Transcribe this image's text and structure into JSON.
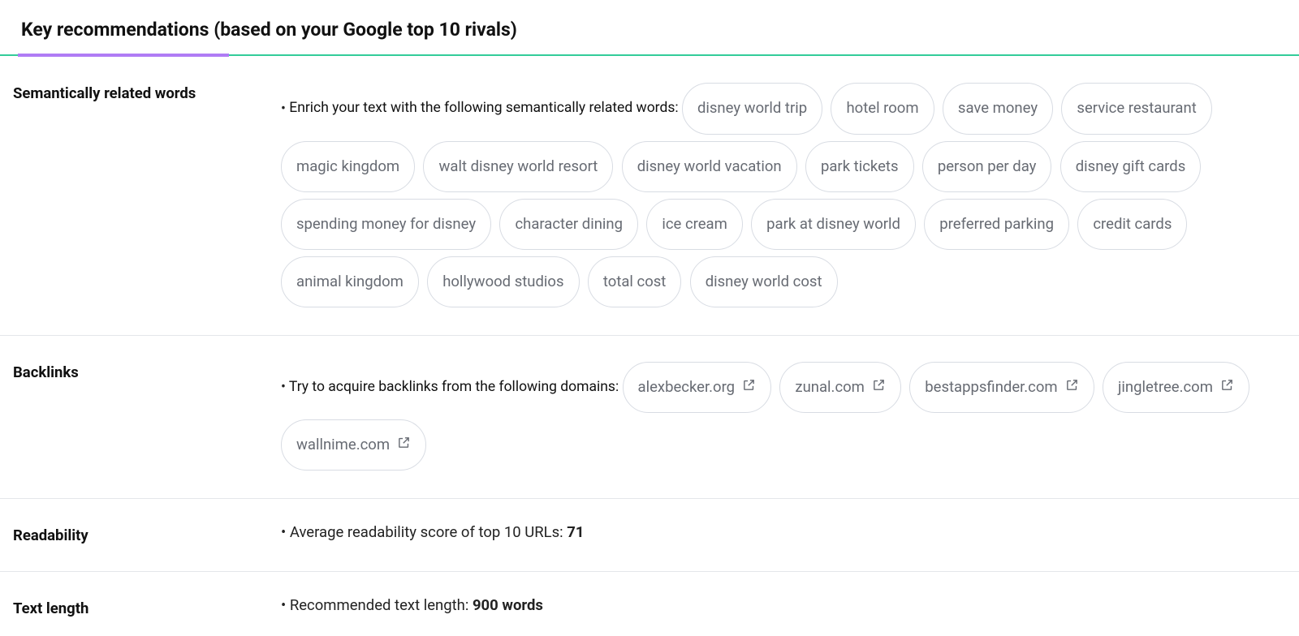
{
  "header": {
    "title": "Key recommendations (based on your Google top 10 rivals)"
  },
  "sections": {
    "semantic": {
      "label": "Semantically related words",
      "lead": "Enrich your text with the following semantically related words:",
      "words": [
        "disney world trip",
        "hotel room",
        "save money",
        "service restaurant",
        "magic kingdom",
        "walt disney world resort",
        "disney world vacation",
        "park tickets",
        "person per day",
        "disney gift cards",
        "spending money for disney",
        "character dining",
        "ice cream",
        "park at disney world",
        "preferred parking",
        "credit cards",
        "animal kingdom",
        "hollywood studios",
        "total cost",
        "disney world cost"
      ]
    },
    "backlinks": {
      "label": "Backlinks",
      "lead": "Try to acquire backlinks from the following domains:",
      "domains": [
        "alexbecker.org",
        "zunal.com",
        "bestappsfinder.com",
        "jingletree.com",
        "wallnime.com"
      ]
    },
    "readability": {
      "label": "Readability",
      "lead": "Average readability score of top 10 URLs: ",
      "value": "71"
    },
    "textlength": {
      "label": "Text length",
      "lead": "Recommended text length: ",
      "value": "900 words"
    }
  }
}
